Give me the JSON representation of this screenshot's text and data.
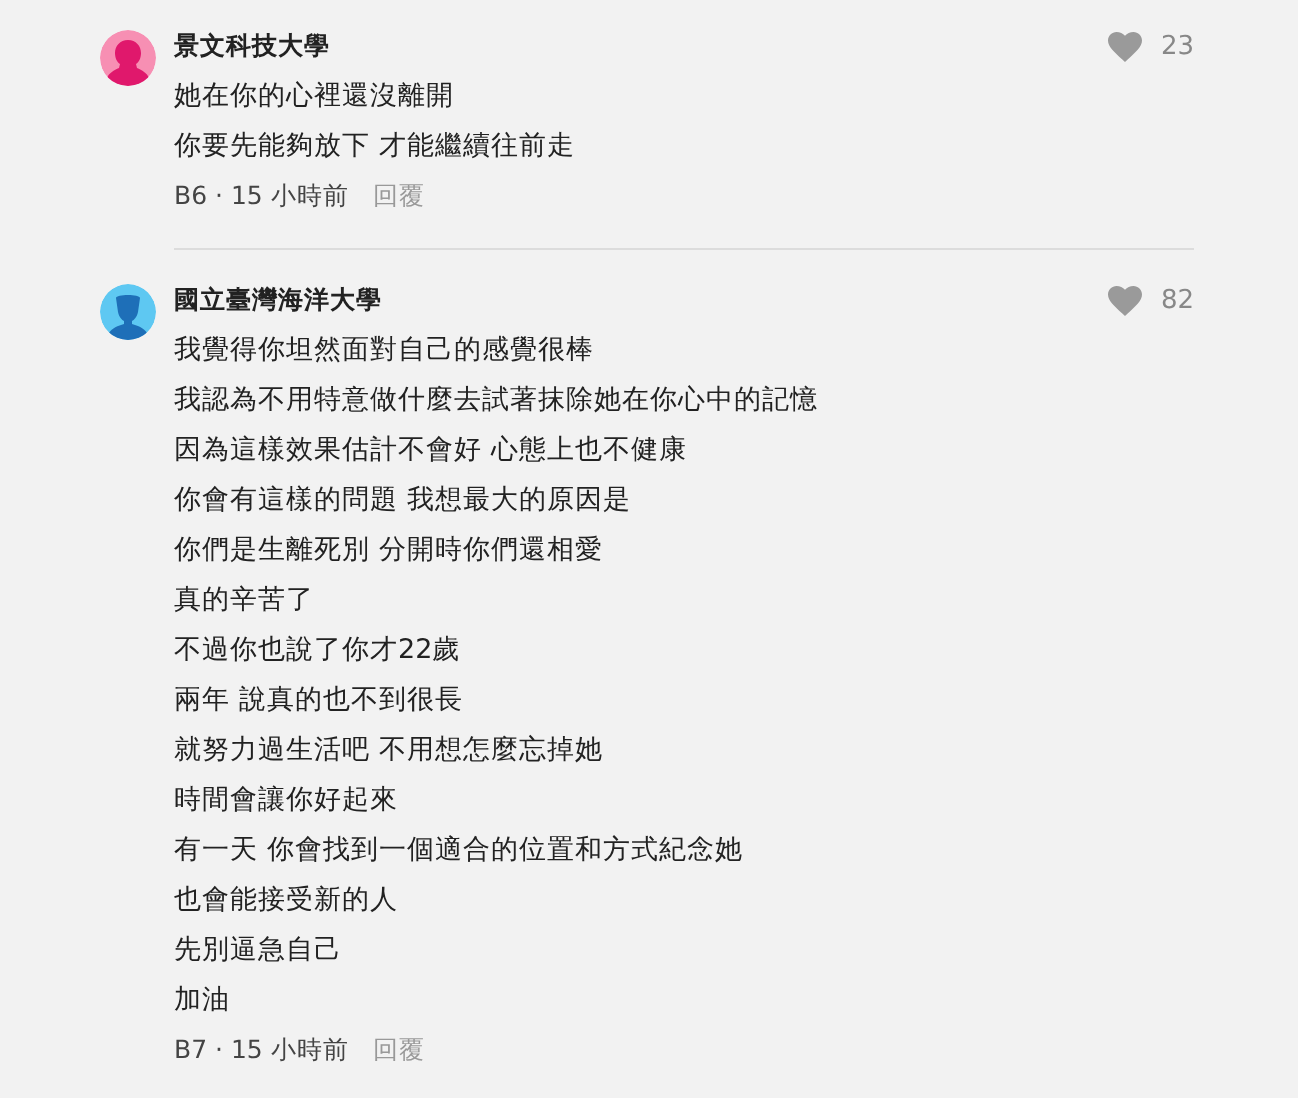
{
  "comments": [
    {
      "author": "景文科技大學",
      "avatar": {
        "kind": "female",
        "color": "#f78fb3"
      },
      "likes": "23",
      "lines": [
        "她在你的心裡還沒離開",
        "你要先能夠放下 才能繼續往前走"
      ],
      "meta": "B6 · 15 小時前",
      "reply": "回覆"
    },
    {
      "author": "國立臺灣海洋大學",
      "avatar": {
        "kind": "male",
        "color": "#5ec8f2"
      },
      "likes": "82",
      "lines": [
        "我覺得你坦然面對自己的感覺很棒",
        "我認為不用特意做什麼去試著抹除她在你心中的記憶",
        "因為這樣效果估計不會好 心態上也不健康",
        "你會有這樣的問題 我想最大的原因是",
        "你們是生離死別 分開時你們還相愛",
        "真的辛苦了",
        "不過你也說了你才22歲",
        "兩年 說真的也不到很長",
        "就努力過生活吧 不用想怎麼忘掉她",
        "時間會讓你好起來",
        "有一天 你會找到一個適合的位置和方式紀念她",
        "也會能接受新的人",
        "先別逼急自己",
        "加油"
      ],
      "meta": "B7 · 15 小時前",
      "reply": "回覆"
    }
  ]
}
